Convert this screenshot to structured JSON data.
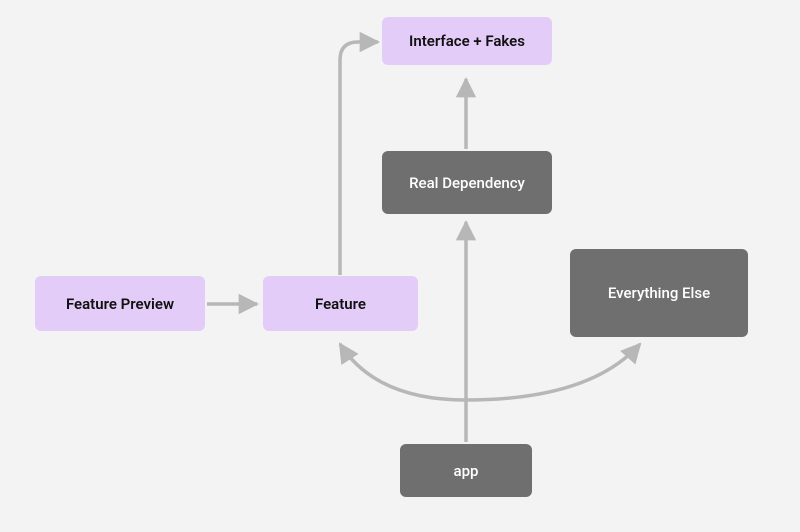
{
  "nodes": {
    "interface_fakes": {
      "label": "Interface + Fakes"
    },
    "feature_preview": {
      "label": "Feature Preview"
    },
    "feature": {
      "label": "Feature"
    },
    "real_dependency": {
      "label": "Real Dependency"
    },
    "everything_else": {
      "label": "Everything Else"
    },
    "app": {
      "label": "app"
    }
  },
  "colors": {
    "purple_bg": "#e3cdf8",
    "gray_bg": "#6f6f6f",
    "arrow": "#b8b7b8",
    "canvas": "#f4f3f4"
  },
  "edges": [
    {
      "from": "feature_preview",
      "to": "feature"
    },
    {
      "from": "feature",
      "to": "interface_fakes"
    },
    {
      "from": "real_dependency",
      "to": "interface_fakes"
    },
    {
      "from": "app",
      "to": "feature"
    },
    {
      "from": "app",
      "to": "real_dependency"
    },
    {
      "from": "app",
      "to": "everything_else"
    }
  ]
}
